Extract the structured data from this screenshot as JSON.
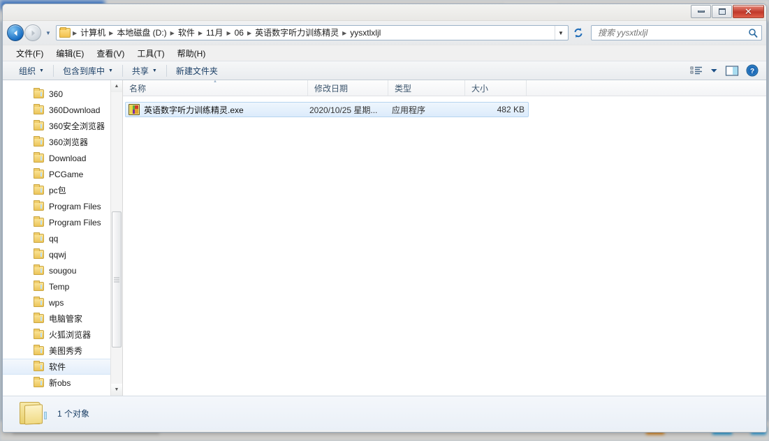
{
  "window": {
    "controls": {
      "minimize_label": "最小化",
      "maximize_label": "最大化",
      "close_label": "✕"
    }
  },
  "navigation": {
    "back_label": "◀",
    "forward_label": "▶",
    "history_dropdown_label": "▼",
    "address_dropdown_label": "▼",
    "refresh_label": "刷新"
  },
  "address": {
    "folder_icon": "folder-icon",
    "crumbs": [
      {
        "label": "计算机",
        "sep": "▶"
      },
      {
        "label": "本地磁盘 (D:)",
        "sep": "▶"
      },
      {
        "label": "软件",
        "sep": "▶"
      },
      {
        "label": "11月",
        "sep": "▶"
      },
      {
        "label": "06",
        "sep": "▶"
      },
      {
        "label": "英语数字听力训练精灵",
        "sep": "▶"
      },
      {
        "label": "yysxtlxljl",
        "sep": ""
      }
    ]
  },
  "search": {
    "placeholder": "搜索 yysxtlxljl",
    "value": "",
    "icon": "search-icon"
  },
  "menubar": {
    "items": [
      {
        "label": "文件(F)"
      },
      {
        "label": "编辑(E)"
      },
      {
        "label": "查看(V)"
      },
      {
        "label": "工具(T)"
      },
      {
        "label": "帮助(H)"
      }
    ]
  },
  "toolbar": {
    "organize_label": "组织",
    "include_library_label": "包含到库中",
    "share_label": "共享",
    "new_folder_label": "新建文件夹",
    "caret": "▼",
    "view_icon": "view-list-icon",
    "view_caret": "▼",
    "preview_icon": "preview-pane-icon",
    "help_icon": "help-icon"
  },
  "sidebar": {
    "items": [
      {
        "label": "360",
        "selected": false
      },
      {
        "label": "360Download",
        "selected": false
      },
      {
        "label": "360安全浏览器",
        "selected": false
      },
      {
        "label": "360浏览器",
        "selected": false
      },
      {
        "label": "Download",
        "selected": false
      },
      {
        "label": "PCGame",
        "selected": false
      },
      {
        "label": "pc包",
        "selected": false
      },
      {
        "label": "Program Files",
        "selected": false
      },
      {
        "label": "Program Files",
        "selected": false
      },
      {
        "label": "qq",
        "selected": false
      },
      {
        "label": "qqwj",
        "selected": false
      },
      {
        "label": "sougou",
        "selected": false
      },
      {
        "label": "Temp",
        "selected": false
      },
      {
        "label": "wps",
        "selected": false
      },
      {
        "label": "电脑管家",
        "selected": false
      },
      {
        "label": "火狐浏览器",
        "selected": false
      },
      {
        "label": "美图秀秀",
        "selected": false
      },
      {
        "label": "软件",
        "selected": true
      },
      {
        "label": "新obs",
        "selected": false
      }
    ],
    "scroll_up_label": "▲",
    "scroll_down_label": "▼"
  },
  "filelist": {
    "columns": [
      {
        "label": "名称",
        "sorted": true
      },
      {
        "label": "修改日期",
        "sorted": false
      },
      {
        "label": "类型",
        "sorted": false
      },
      {
        "label": "大小",
        "sorted": false
      }
    ],
    "rows": [
      {
        "icon": "application-exe-icon",
        "name": "英语数字听力训练精灵.exe",
        "date": "2020/10/25 星期...",
        "type": "应用程序",
        "size": "482 KB",
        "selected": true
      }
    ]
  },
  "statusbar": {
    "icon": "folder-large-icon",
    "text": "1 个对象"
  },
  "colors": {
    "accent": "#1b3f66",
    "selection": "#dcebfb",
    "selection_border": "#b6d4f0",
    "folder": "#ecc55a",
    "close_button": "#c0392b"
  }
}
